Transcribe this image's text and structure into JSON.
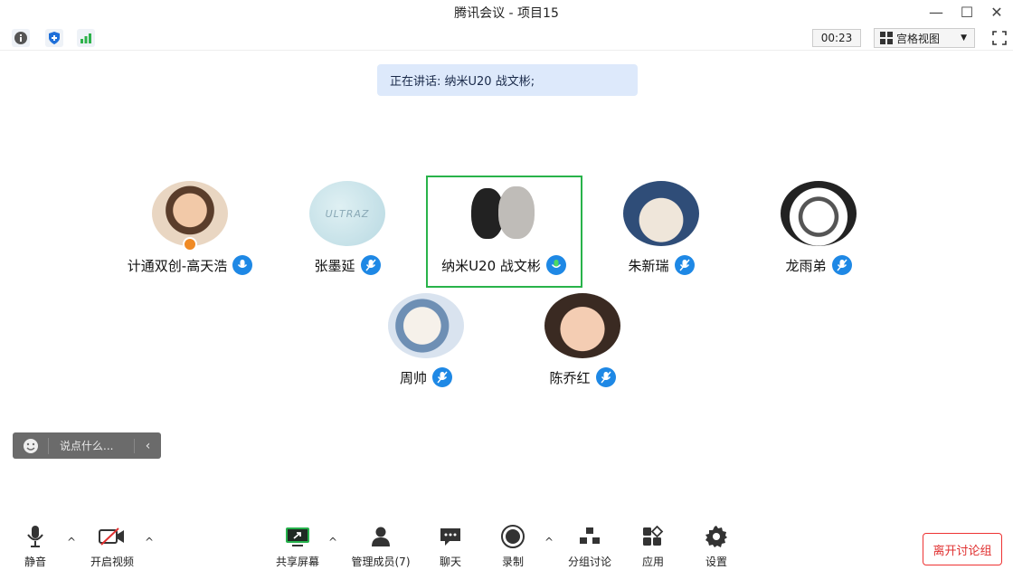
{
  "window": {
    "title": "腾讯会议 - 项目15",
    "minimize": "—",
    "maximize": "☐",
    "close": "✕"
  },
  "topbar": {
    "timer": "00:23",
    "view_mode": "宫格视图"
  },
  "speaking_banner": "正在讲话: 纳米U20 战文彬;",
  "participants": [
    {
      "name": "计通双创-高天浩",
      "role": "host"
    },
    {
      "name": "张墨延"
    },
    {
      "name": "纳米U20 战文彬",
      "speaking": true
    },
    {
      "name": "朱新瑞"
    },
    {
      "name": "龙雨弟"
    },
    {
      "name": "周帅"
    },
    {
      "name": "陈乔红"
    }
  ],
  "avatar2_text": "ULTRAZ",
  "chat": {
    "placeholder": "说点什么..."
  },
  "bottom": {
    "mute": "静音",
    "video": "开启视频",
    "share": "共享屏幕",
    "members": "管理成员(7)",
    "chat": "聊天",
    "record": "录制",
    "breakout": "分组讨论",
    "apps": "应用",
    "settings": "设置",
    "leave": "离开讨论组"
  },
  "colors": {
    "accent": "#1e88e5",
    "speaking_border": "#29b34a",
    "leave": "#e03030"
  }
}
